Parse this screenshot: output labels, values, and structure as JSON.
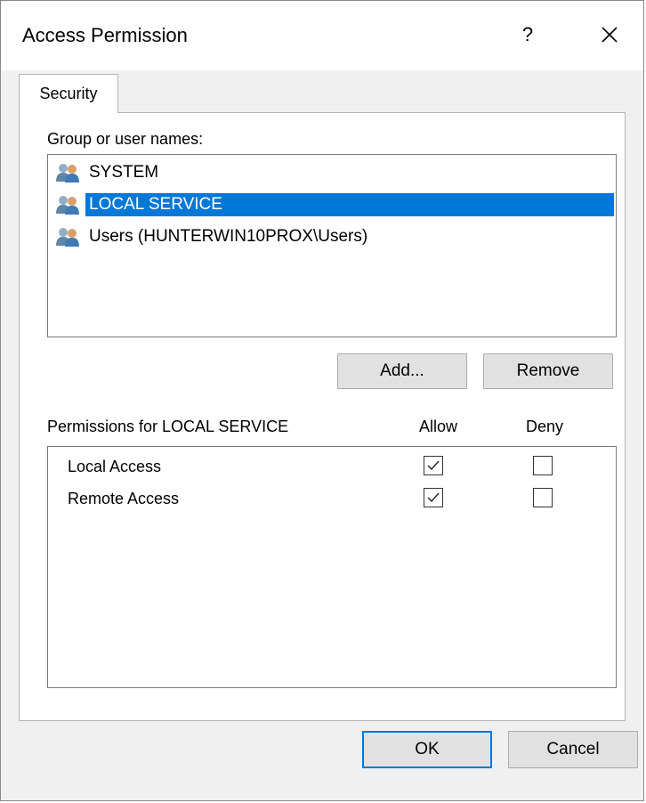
{
  "dialog": {
    "title": "Access Permission",
    "help_label": "?",
    "close_icon": "close-icon"
  },
  "tabs": [
    {
      "label": "Security",
      "active": true
    }
  ],
  "group_section": {
    "label": "Group or user names:",
    "users": [
      {
        "name": "SYSTEM",
        "icon": "users-icon",
        "selected": false
      },
      {
        "name": "LOCAL SERVICE",
        "icon": "users-icon",
        "selected": true
      },
      {
        "name": "Users (HUNTERWIN10PROX\\Users)",
        "icon": "users-icon",
        "selected": false
      }
    ],
    "add_label": "Add...",
    "remove_label": "Remove"
  },
  "permissions": {
    "label": "Permissions for LOCAL SERVICE",
    "allow_header": "Allow",
    "deny_header": "Deny",
    "rows": [
      {
        "name": "Local Access",
        "allow": true,
        "deny": false
      },
      {
        "name": "Remote Access",
        "allow": true,
        "deny": false
      }
    ]
  },
  "footer": {
    "ok_label": "OK",
    "cancel_label": "Cancel"
  },
  "colors": {
    "selection": "#0078d7",
    "dialog_bg": "#f0f0f0",
    "button_bg": "#e1e1e1"
  }
}
